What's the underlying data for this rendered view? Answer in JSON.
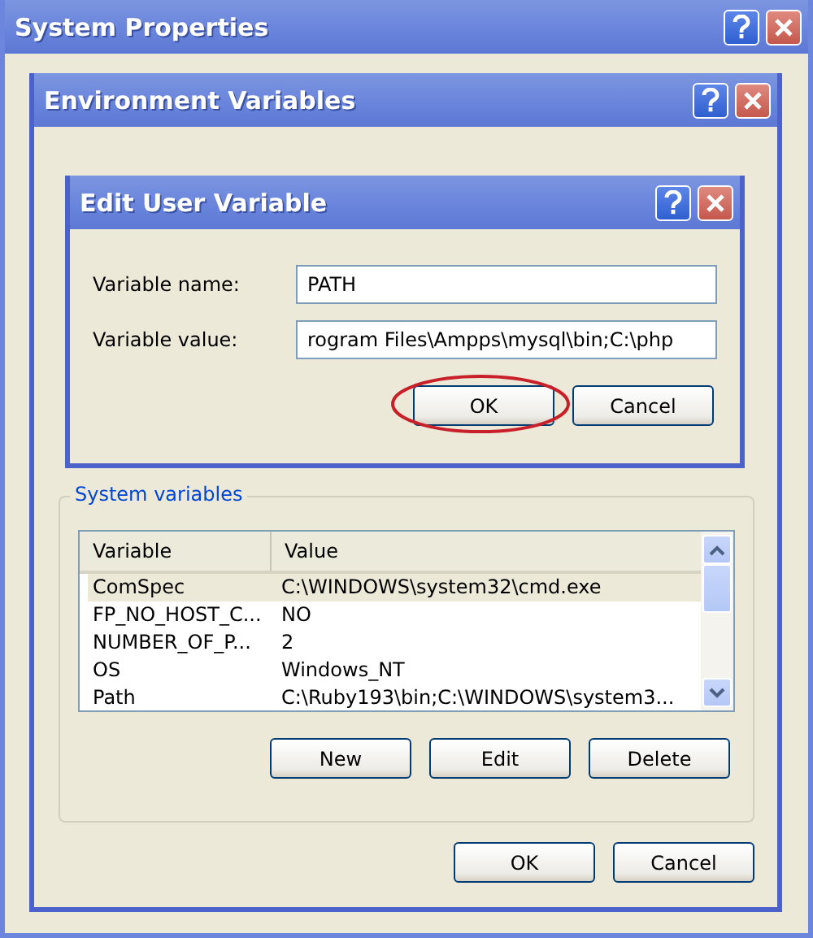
{
  "system_properties": {
    "title": "System Properties"
  },
  "environment_variables": {
    "title": "Environment Variables",
    "system_variables": {
      "label": "System variables",
      "columns": [
        "Variable",
        "Value"
      ],
      "rows": [
        {
          "variable": "ComSpec",
          "value": "C:\\WINDOWS\\system32\\cmd.exe",
          "selected": true
        },
        {
          "variable": "FP_NO_HOST_C...",
          "value": "NO",
          "selected": false
        },
        {
          "variable": "NUMBER_OF_P...",
          "value": "2",
          "selected": false
        },
        {
          "variable": "OS",
          "value": "Windows_NT",
          "selected": false
        },
        {
          "variable": "Path",
          "value": "C:\\Ruby193\\bin;C:\\WINDOWS\\system3...",
          "selected": false
        }
      ],
      "buttons": [
        "New",
        "Edit",
        "Delete"
      ]
    },
    "buttons": [
      "OK",
      "Cancel"
    ]
  },
  "edit_user_variable": {
    "title": "Edit User Variable",
    "fields": [
      {
        "label": "Variable name:",
        "value": "PATH"
      },
      {
        "label": "Variable value:",
        "value": "rogram Files\\Ampps\\mysql\\bin;C:\\php"
      }
    ],
    "buttons": [
      {
        "label": "OK",
        "circled": true
      },
      {
        "label": "Cancel",
        "circled": false
      }
    ]
  }
}
